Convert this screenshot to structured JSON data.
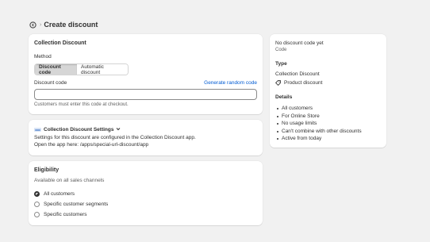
{
  "header": {
    "title": "Create discount"
  },
  "main_card": {
    "title": "Collection Discount",
    "method_label": "Method",
    "method_options": [
      "Discount code",
      "Automatic discount"
    ],
    "selected_method": "Discount code",
    "code_label": "Discount code",
    "generate_link": "Generate random code",
    "code_value": "",
    "help_text": "Customers must enter this code at checkout."
  },
  "settings_card": {
    "title": "Collection Discount Settings",
    "line1": "Settings for this discount are configured in the Collection Discount app.",
    "line2": "Open the app here: /apps/special-url-discount/app"
  },
  "eligibility_card": {
    "title": "Eligibility",
    "subtitle": "Available on all sales channels",
    "options": [
      "All customers",
      "Specific customer segments",
      "Specific customers"
    ],
    "selected": "All customers"
  },
  "summary_card": {
    "code_heading": "No discount code yet",
    "code_sub": "Code",
    "type_heading": "Type",
    "type_value": "Collection Discount",
    "type_detail": "Product discount",
    "details_heading": "Details",
    "details": [
      "All customers",
      "For Online Store",
      "No usage limits",
      "Can't combine with other discounts",
      "Active from today"
    ]
  },
  "colors": {
    "link": "#005bd3",
    "background": "#f1f1f1",
    "card": "#ffffff"
  },
  "icons": {
    "back": "back-arrow-circle-icon",
    "app": "app-icon",
    "chevron": "chevron-down-icon",
    "tag": "tag-icon"
  }
}
